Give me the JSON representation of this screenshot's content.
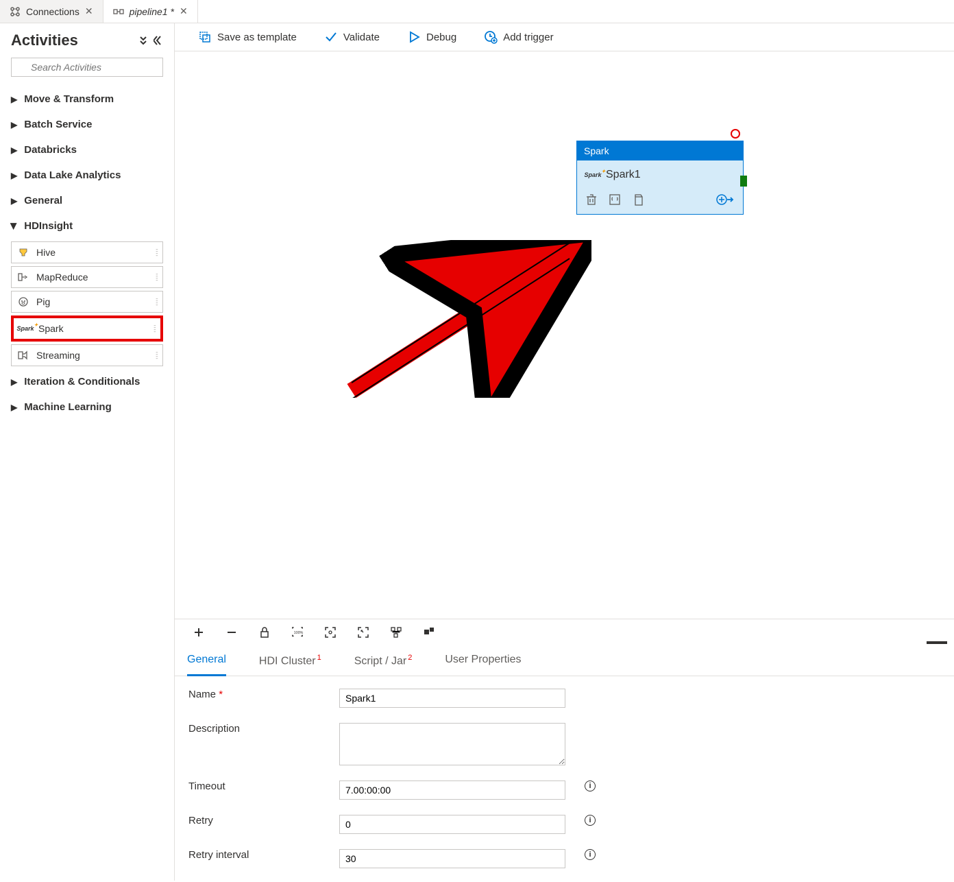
{
  "tabs": [
    {
      "label": "Connections",
      "active": false
    },
    {
      "label": "pipeline1 *",
      "active": true
    }
  ],
  "sidebar": {
    "title": "Activities",
    "search_placeholder": "Search Activities",
    "categories": [
      {
        "label": "Move & Transform",
        "expanded": false
      },
      {
        "label": "Batch Service",
        "expanded": false
      },
      {
        "label": "Databricks",
        "expanded": false
      },
      {
        "label": "Data Lake Analytics",
        "expanded": false
      },
      {
        "label": "General",
        "expanded": false
      },
      {
        "label": "HDInsight",
        "expanded": true,
        "items": [
          {
            "label": "Hive",
            "icon": "hive"
          },
          {
            "label": "MapReduce",
            "icon": "mapreduce"
          },
          {
            "label": "Pig",
            "icon": "pig"
          },
          {
            "label": "Spark",
            "icon": "spark",
            "highlighted": true
          },
          {
            "label": "Streaming",
            "icon": "streaming"
          }
        ]
      },
      {
        "label": "Iteration & Conditionals",
        "expanded": false
      },
      {
        "label": "Machine Learning",
        "expanded": false
      }
    ]
  },
  "toolbar": {
    "save_template": "Save as template",
    "validate": "Validate",
    "debug": "Debug",
    "add_trigger": "Add trigger"
  },
  "node": {
    "type": "Spark",
    "name": "Spark1"
  },
  "prop_tabs": [
    {
      "label": "General",
      "active": true
    },
    {
      "label": "HDI Cluster",
      "badge": "1"
    },
    {
      "label": "Script / Jar",
      "badge": "2"
    },
    {
      "label": "User Properties"
    }
  ],
  "form": {
    "name_label": "Name",
    "name_value": "Spark1",
    "desc_label": "Description",
    "desc_value": "",
    "timeout_label": "Timeout",
    "timeout_value": "7.00:00:00",
    "retry_label": "Retry",
    "retry_value": "0",
    "retry_interval_label": "Retry interval",
    "retry_interval_value": "30"
  }
}
